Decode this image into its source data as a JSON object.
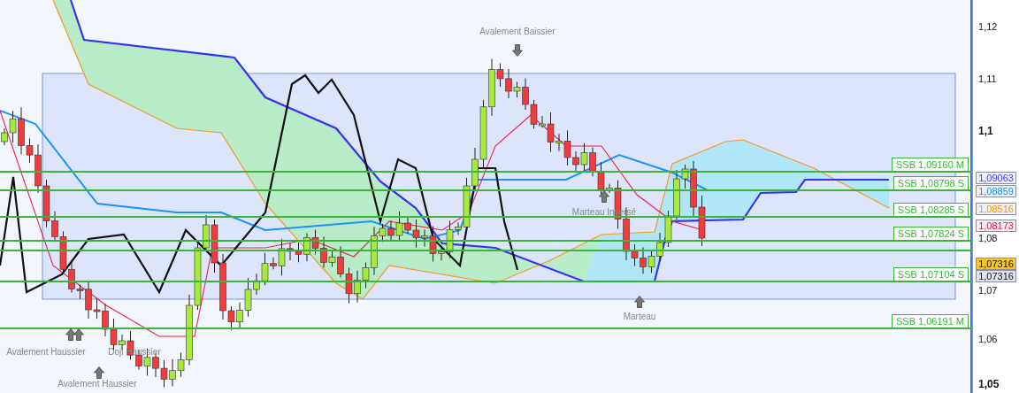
{
  "chart": {
    "y_axis_ticks": [
      {
        "label": "1,12",
        "bold": false
      },
      {
        "label": "1,11",
        "bold": false
      },
      {
        "label": "1,1",
        "bold": true
      },
      {
        "label": "1,08",
        "bold": false
      },
      {
        "label": "1,07",
        "bold": false
      },
      {
        "label": "1,06",
        "bold": false
      },
      {
        "label": "1,05",
        "bold": true
      }
    ],
    "levels": [
      {
        "label": "SSB 1,09160 M"
      },
      {
        "label": "SSB 1,08798 S"
      },
      {
        "label": "SSB 1,08285 S"
      },
      {
        "label": "SSB 1,07824 S"
      },
      {
        "label": "SSB 1,07104 S"
      },
      {
        "label": "SSB 1,06191 M"
      }
    ],
    "price_tags": [
      {
        "label": "1,09063",
        "kind": "line",
        "color": "#3c3cf0"
      },
      {
        "label": "1,08859",
        "kind": "line",
        "color": "#1e8ce6"
      },
      {
        "label": "1,08516",
        "kind": "line",
        "color": "#f0961e"
      },
      {
        "label": "1,08173",
        "kind": "line",
        "color": "#e6143c"
      },
      {
        "label": "1,07316",
        "kind": "last"
      },
      {
        "label": "1,07316",
        "kind": "close"
      }
    ],
    "annotations": [
      {
        "label": "Avalement Baissier",
        "kind": "down"
      },
      {
        "label": "Marteau Inversé",
        "kind": "up"
      },
      {
        "label": "Marteau",
        "kind": "up"
      },
      {
        "label": "Avalement Haussier",
        "kind": "up"
      },
      {
        "label": "Doji Haussier",
        "kind": "up"
      },
      {
        "label": "Avalement Haussier",
        "kind": "up"
      }
    ]
  }
}
